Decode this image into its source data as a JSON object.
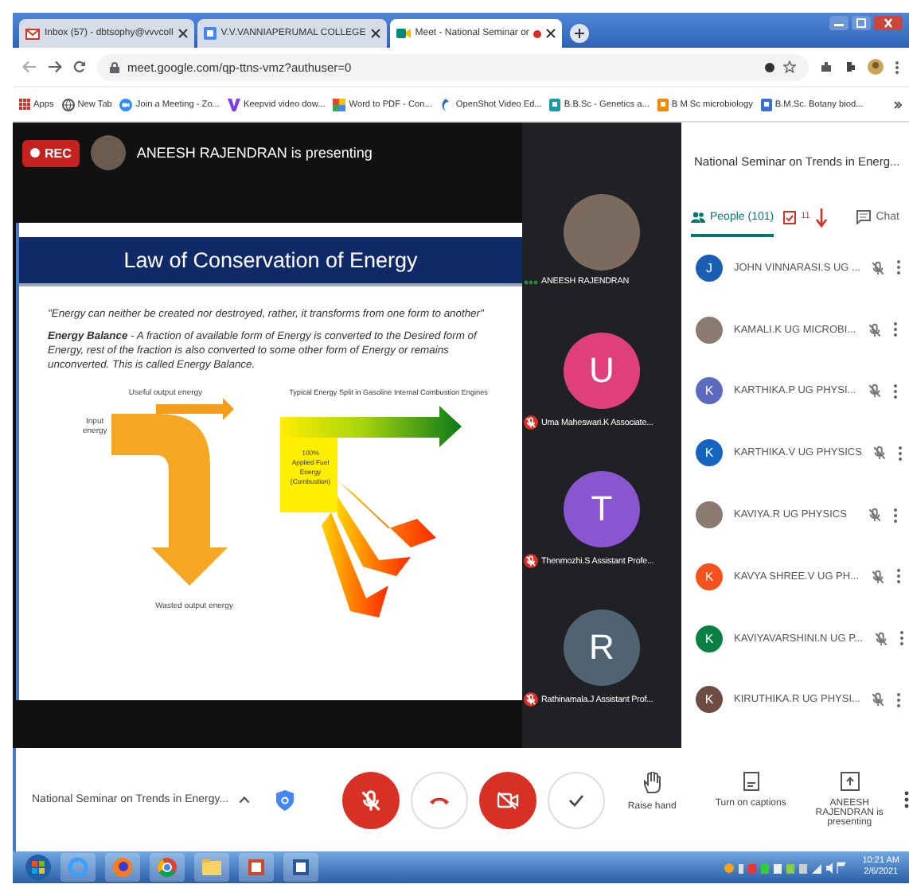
{
  "browser": {
    "tabs": [
      {
        "title": "Inbox (57) - dbtsophy@vvvcoll",
        "kind": "mail",
        "selected": false
      },
      {
        "title": "V.V.VANNIAPERUMAL COLLEGE",
        "kind": "college",
        "selected": false
      },
      {
        "title": "Meet - National Seminar or",
        "kind": "meet",
        "selected": true,
        "recording": true
      }
    ],
    "url": "meet.google.com/qp-ttns-vmz?authuser=0",
    "bookmarks": [
      {
        "label": "Apps",
        "kind": "apps"
      },
      {
        "label": "New Tab",
        "kind": "globe"
      },
      {
        "label": "Join a Meeting - Zo...",
        "kind": "zoom"
      },
      {
        "label": "Keepvid video dow...",
        "kind": "keepvid"
      },
      {
        "label": "Word to PDF - Con...",
        "kind": "pdf"
      },
      {
        "label": "OpenShot Video Ed...",
        "kind": "openshot"
      },
      {
        "label": "B.B.Sc - Genetics a...",
        "kind": "teal"
      },
      {
        "label": "B M Sc microbiology",
        "kind": "orange"
      },
      {
        "label": "B.M.Sc. Botany biod...",
        "kind": "blue"
      }
    ]
  },
  "meeting": {
    "rec_label": "REC",
    "banner": "ANEESH RAJENDRAN is presenting",
    "slide": {
      "title": "Law of Conservation of Energy",
      "quote": "\"Energy can neither be created nor destroyed, rather, it transforms from one form to another\"",
      "paragraph": "**Energy Balance** - A fraction of available form of Energy is converted to the Desired form of Energy, rest of the fraction is also converted to some other form of Energy or remains unconverted. This is called Energy Balance.",
      "useful_label": "Useful output energy",
      "input_label": "Input energy",
      "wasted_label": "Wasted output energy",
      "split_title": "Typical Energy Split in Gasoline Internal Combustion Engines",
      "fuel_label": "100% Applied Fuel Energy (Combustion)"
    },
    "tiles": [
      {
        "name": "ANEESH RAJENDRAN",
        "kind": "photo",
        "muted": false
      },
      {
        "name": "Uma Maheswari.K Associate...",
        "kind": "letter",
        "letter": "U",
        "color": "#e0407a",
        "muted": true
      },
      {
        "name": "Thenmozhi.S Assistant Profe...",
        "kind": "letter",
        "letter": "T",
        "color": "#8a56d0",
        "muted": true
      },
      {
        "name": "Rathinamala.J Assistant Prof...",
        "kind": "letter",
        "letter": "R",
        "color": "#4f6470",
        "muted": true
      }
    ]
  },
  "panel": {
    "title": "National Seminar on Trends in Energ...",
    "tabs": [
      {
        "label": "People (101)",
        "kind": "people",
        "selected": true
      },
      {
        "label": "11",
        "kind": "tasks",
        "selected": false
      },
      {
        "label": "Chat",
        "kind": "chat",
        "selected": false
      }
    ],
    "people": [
      {
        "name": "JOHN VINNARASI.S UG ...",
        "kind": "letter",
        "letter": "J",
        "color": "#1a5fb4"
      },
      {
        "name": "KAMALI.K UG MICROBI...",
        "kind": "photo"
      },
      {
        "name": "KARTHIKA.P UG PHYSI...",
        "kind": "letter",
        "letter": "K",
        "color": "#5c6bc0"
      },
      {
        "name": "KARTHIKA.V UG PHYSICS",
        "kind": "letter",
        "letter": "K",
        "color": "#1565c0"
      },
      {
        "name": "KAVIYA.R UG PHYSICS",
        "kind": "photo"
      },
      {
        "name": "KAVYA SHREE.V UG PH...",
        "kind": "letter",
        "letter": "K",
        "color": "#f4511e"
      },
      {
        "name": "KAVIYAVARSHINI.N UG P...",
        "kind": "letter",
        "letter": "K",
        "color": "#0b8043"
      },
      {
        "name": "KIRUTHIKA.R UG PHYSI...",
        "kind": "letter",
        "letter": "K",
        "color": "#6d4c41"
      }
    ]
  },
  "controls": {
    "meeting_title": "National Seminar on Trends in Energy...",
    "mic_on": false,
    "camera_on": false,
    "actions": [
      {
        "label": "Raise hand",
        "kind": "hand"
      },
      {
        "label": "Turn on captions",
        "kind": "captions"
      },
      {
        "label": "ANEESH RAJENDRAN is presenting",
        "kind": "present"
      }
    ]
  },
  "taskbar": {
    "time": "10:21 AM",
    "date": "2/6/2021"
  }
}
